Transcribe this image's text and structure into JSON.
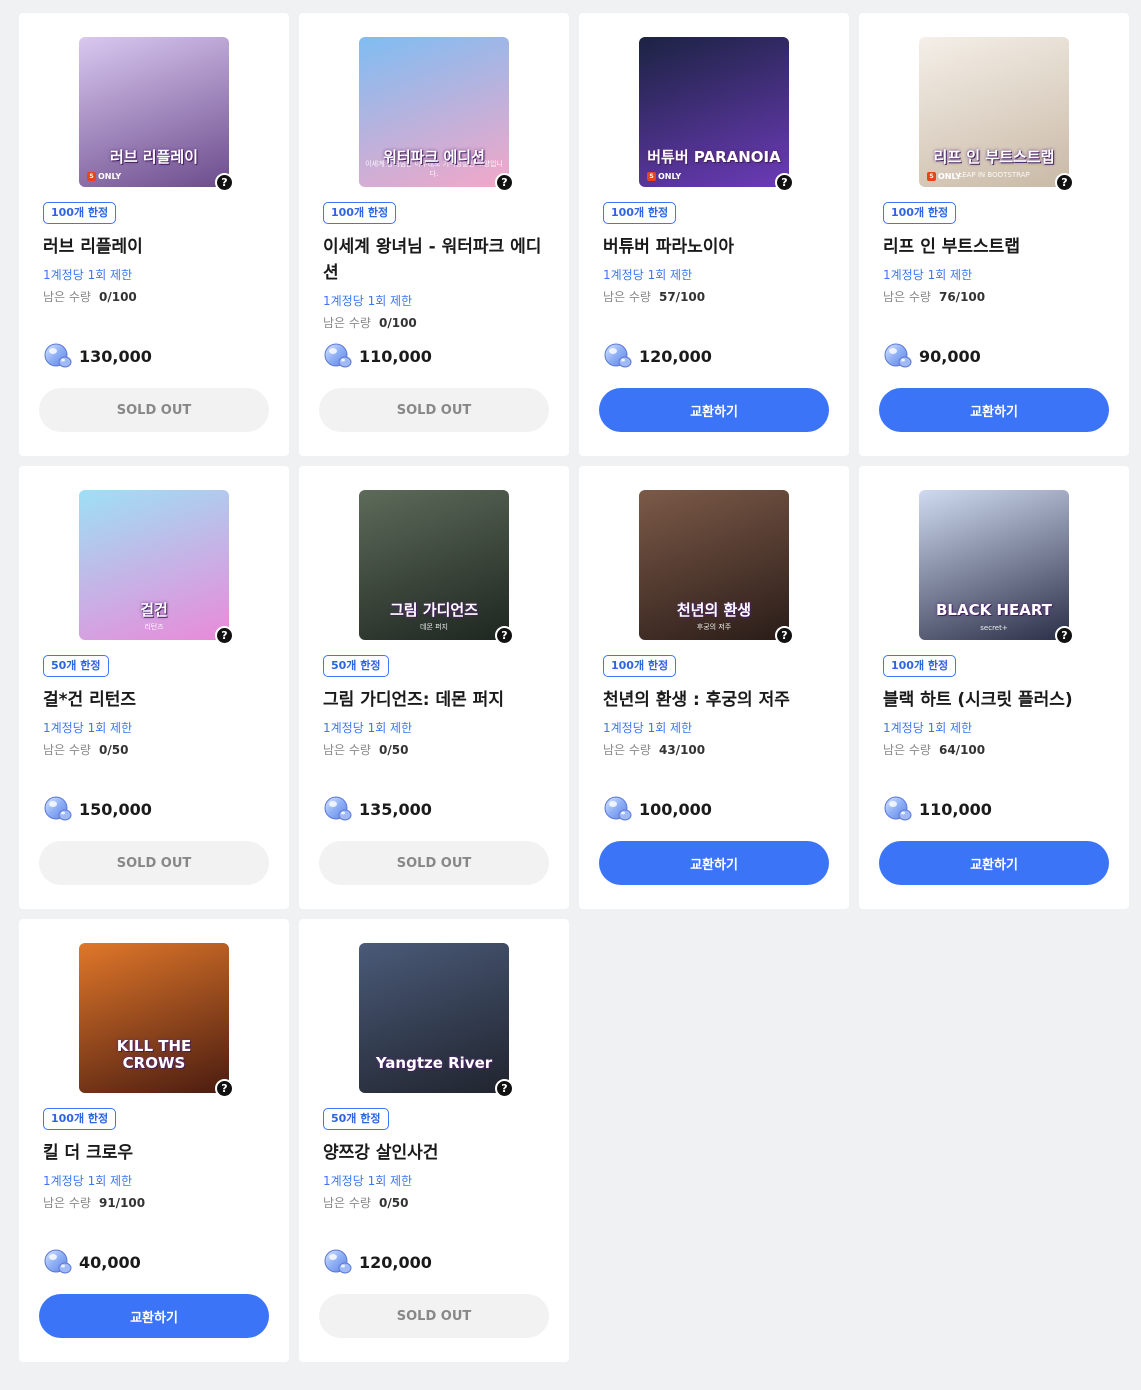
{
  "theme": {
    "accent": "#3b74f7",
    "soldout_bg": "#f2f2f2",
    "page_bg": "#f0f1f3"
  },
  "labels": {
    "per_account": "1계정당 1회 제한",
    "remaining_prefix": "남은 수량",
    "help_glyph": "?",
    "only_text": "ONLY",
    "only_s": "S"
  },
  "products": [
    {
      "limit_badge": "100개 한정",
      "title": "러브 리플레이",
      "remaining": "0/100",
      "price": "130,000",
      "button": "SOLD OUT",
      "sold_out": true,
      "thumb_text": "러브 리플레이",
      "thumb_sub": "",
      "only": true,
      "thumb_colors": [
        "#d9c8f0",
        "#6c4c8c"
      ]
    },
    {
      "limit_badge": "100개 한정",
      "title": "이세계 왕녀님 - 워터파크 에디션",
      "remaining": "0/100",
      "price": "110,000",
      "button": "SOLD OUT",
      "sold_out": true,
      "thumb_text": "워터파크 에디션",
      "thumb_sub": "이세계 왕녀님은 아무래도 기억상실인 모양입니다.",
      "only": false,
      "thumb_colors": [
        "#7fbdf2",
        "#f3a7c8"
      ]
    },
    {
      "limit_badge": "100개 한정",
      "title": "버튜버 파라노이아",
      "remaining": "57/100",
      "price": "120,000",
      "button": "교환하기",
      "sold_out": false,
      "thumb_text": "버튜버 PARANOIA",
      "thumb_sub": "",
      "only": true,
      "thumb_colors": [
        "#1b2342",
        "#6c3bb8"
      ]
    },
    {
      "limit_badge": "100개 한정",
      "title": "리프 인 부트스트랩",
      "remaining": "76/100",
      "price": "90,000",
      "button": "교환하기",
      "sold_out": false,
      "thumb_text": "리프 인 부트스트랩",
      "thumb_sub": "LEAP IN BOOTSTRAP",
      "only": true,
      "thumb_colors": [
        "#f4efe8",
        "#c9b9a6"
      ]
    },
    {
      "limit_badge": "50개 한정",
      "title": "걸*건 리턴즈",
      "remaining": "0/50",
      "price": "150,000",
      "button": "SOLD OUT",
      "sold_out": true,
      "thumb_text": "걸건",
      "thumb_sub": "리턴즈",
      "only": false,
      "thumb_colors": [
        "#9ee0f5",
        "#e98ad8"
      ]
    },
    {
      "limit_badge": "50개 한정",
      "title": "그림 가디언즈: 데몬 퍼지",
      "remaining": "0/50",
      "price": "135,000",
      "button": "SOLD OUT",
      "sold_out": true,
      "thumb_text": "그림 가디언즈",
      "thumb_sub": "데몬 퍼지",
      "only": false,
      "thumb_colors": [
        "#5d6b5a",
        "#1e2620"
      ]
    },
    {
      "limit_badge": "100개 한정",
      "title": "천년의 환생 : 후궁의 저주",
      "remaining": "43/100",
      "price": "100,000",
      "button": "교환하기",
      "sold_out": false,
      "thumb_text": "천년의 환생",
      "thumb_sub": "후궁의 저주",
      "only": false,
      "thumb_colors": [
        "#7c5a48",
        "#2a1c18"
      ]
    },
    {
      "limit_badge": "100개 한정",
      "title": "블랙 하트 (시크릿 플러스)",
      "remaining": "64/100",
      "price": "110,000",
      "button": "교환하기",
      "sold_out": false,
      "thumb_text": "BLACK HEART",
      "thumb_sub": "secret+",
      "only": false,
      "thumb_colors": [
        "#cfdaf0",
        "#2b2f48"
      ]
    },
    {
      "limit_badge": "100개 한정",
      "title": "킬 더 크로우",
      "remaining": "91/100",
      "price": "40,000",
      "button": "교환하기",
      "sold_out": false,
      "thumb_text": "KILL THE CROWS",
      "thumb_sub": "",
      "only": false,
      "thumb_colors": [
        "#e0772a",
        "#4a1c10"
      ]
    },
    {
      "limit_badge": "50개 한정",
      "title": "양쯔강 살인사건",
      "remaining": "0/50",
      "price": "120,000",
      "button": "SOLD OUT",
      "sold_out": true,
      "thumb_text": "Yangtze River",
      "thumb_sub": "",
      "only": false,
      "thumb_colors": [
        "#4a5a78",
        "#20242e"
      ]
    }
  ]
}
